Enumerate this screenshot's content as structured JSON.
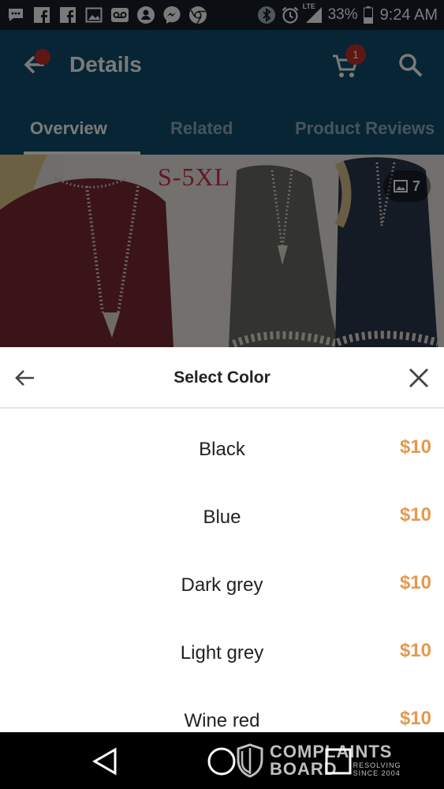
{
  "status_bar": {
    "battery": "33%",
    "time": "9:24 AM",
    "network": "LTE",
    "icons": [
      "message-icon",
      "facebook-icon",
      "facebook-icon",
      "image-icon",
      "voicemail-icon",
      "messenger-icon",
      "messenger-icon",
      "chrome-icon",
      "bluetooth-icon",
      "alarm-icon",
      "signal-icon",
      "battery-icon"
    ]
  },
  "app_bar": {
    "title": "Details",
    "cart_count": "1",
    "tabs": [
      {
        "label": "Overview"
      },
      {
        "label": "Related"
      },
      {
        "label": "Product Reviews"
      }
    ]
  },
  "banner": {
    "size_text": "S-5XL",
    "image_count": "7"
  },
  "sheet": {
    "title": "Select Color",
    "options": [
      {
        "name": "Black",
        "price": "$10"
      },
      {
        "name": "Blue",
        "price": "$10"
      },
      {
        "name": "Dark grey",
        "price": "$10"
      },
      {
        "name": "Light grey",
        "price": "$10"
      },
      {
        "name": "Wine red",
        "price": "$10"
      }
    ]
  },
  "watermark": {
    "line1": "COMPLAINTS",
    "line2": "BOARD",
    "tag1": "RESOLVING",
    "tag2": "SINCE 2004"
  },
  "colors": {
    "app_bar": "#0f4f6e",
    "badge": "#c6302a",
    "price": "#e39a4f",
    "status_bar": "#18212a"
  }
}
